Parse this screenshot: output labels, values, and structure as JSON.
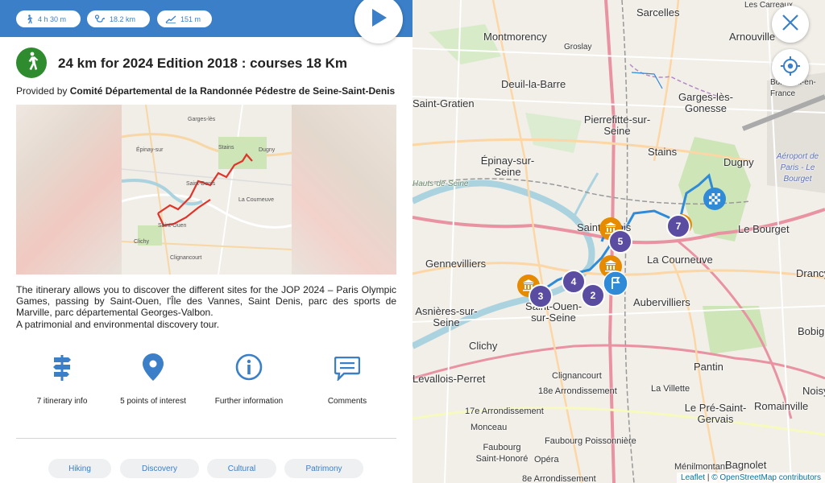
{
  "summary": {
    "duration": "4 h 30 m",
    "distance": "18.2 km",
    "elevation": "151 m",
    "duration_icon": "walker-icon",
    "distance_icon": "route-icon",
    "elevation_icon": "elevation-icon"
  },
  "trek": {
    "title": "24 km for 2024 Edition 2018 : courses 18 Km",
    "provided_prefix": "Provided by",
    "provider": "Comité Départemental de la Randonnée Pédestre de Seine-Saint-Denis",
    "description": [
      "The itinerary allows you to discover the different sites for the JOP 2024 – Paris Olympic Games, passing by Saint-Ouen, l'Île des Vannes, Saint Denis, parc des sports de Marville, parc départemental Georges-Valbon.",
      "A patrimonial and environmental discovery tour."
    ]
  },
  "actions": [
    {
      "label": "7 itinerary info",
      "icon": "signpost-icon",
      "count": "7"
    },
    {
      "label": "5 points of interest",
      "icon": "map-pin-icon",
      "count": "5"
    },
    {
      "label": "Further information",
      "icon": "info-icon"
    },
    {
      "label": "Comments",
      "icon": "comment-icon"
    }
  ],
  "tags": [
    "Hiking",
    "Discovery",
    "Cultural",
    "Patrimony"
  ],
  "map": {
    "labels": [
      {
        "text": "Sarcelles"
      },
      {
        "text": "Les Carreaux"
      },
      {
        "text": "Montmorency"
      },
      {
        "text": "Groslay"
      },
      {
        "text": "Arnouville"
      },
      {
        "text": "Deuil-la-Barre"
      },
      {
        "text": "Bonneuil-en-France"
      },
      {
        "text": "Garges-lès-Gonesse"
      },
      {
        "text": "Saint-Gratien"
      },
      {
        "text": "Pierrefitte-sur-Seine"
      },
      {
        "text": "Stains"
      },
      {
        "text": "Dugny"
      },
      {
        "text": "Aéroport de Paris - Le Bourget"
      },
      {
        "text": "Épinay-sur-Seine"
      },
      {
        "text": "Hauts-de-Seine"
      },
      {
        "text": "Saint-Denis"
      },
      {
        "text": "Le Bourget"
      },
      {
        "text": "Gennevilliers"
      },
      {
        "text": "La Courneuve"
      },
      {
        "text": "Drancy"
      },
      {
        "text": "Saint-Ouen-sur-Seine"
      },
      {
        "text": "Aubervilliers"
      },
      {
        "text": "Asnières-sur-Seine"
      },
      {
        "text": "Clichy"
      },
      {
        "text": "Bobigny"
      },
      {
        "text": "Pantin"
      },
      {
        "text": "Levallois-Perret"
      },
      {
        "text": "Clignancourt"
      },
      {
        "text": "Noisy"
      },
      {
        "text": "18e Arrondissement"
      },
      {
        "text": "La Villette"
      },
      {
        "text": "17e Arrondissement"
      },
      {
        "text": "Le Pré-Saint-Gervais"
      },
      {
        "text": "Romainville"
      },
      {
        "text": "Monceau"
      },
      {
        "text": "Faubourg Saint-Honoré"
      },
      {
        "text": "Faubourg Poissonnière"
      },
      {
        "text": "Opéra"
      },
      {
        "text": "Ménilmontant"
      },
      {
        "text": "Bagnolet"
      },
      {
        "text": "8e Arrondissement"
      }
    ],
    "markers": [
      {
        "number": "7"
      },
      {
        "number": "5"
      },
      {
        "number": "4"
      },
      {
        "number": "3"
      },
      {
        "number": "2"
      }
    ],
    "attribution_leaflet": "Leaflet",
    "attribution_sep": "|",
    "attribution_osm": "© OpenStreetMap contributors",
    "colors": {
      "brand_blue": "#3a7fc7",
      "route_blue": "#2f8ad8",
      "cluster_purple": "#5a4ca0",
      "poi_orange": "#e68a00",
      "activity_green": "#2e8b2e"
    }
  }
}
